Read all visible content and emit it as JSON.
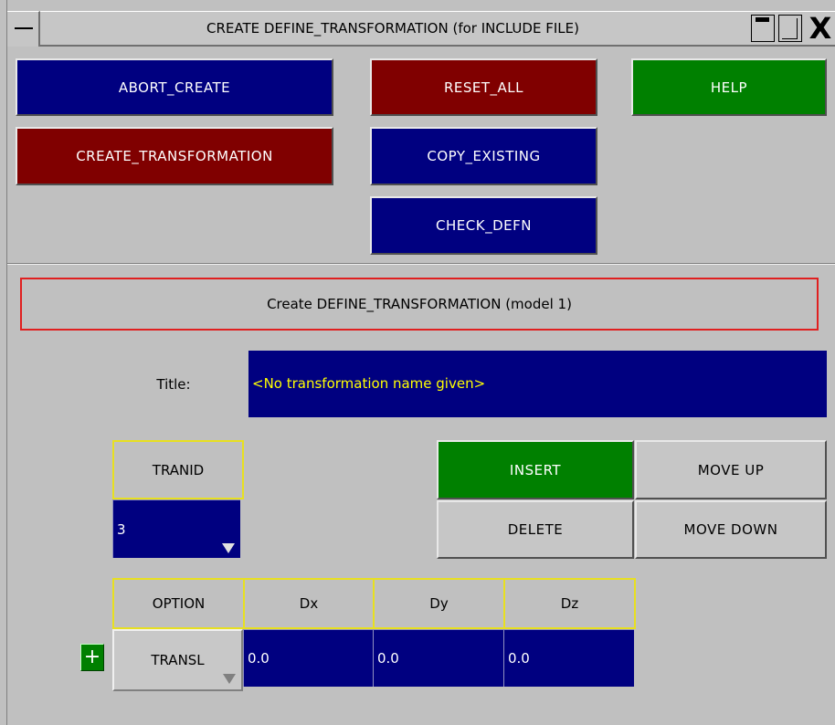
{
  "window": {
    "title": "CREATE DEFINE_TRANSFORMATION (for INCLUDE FILE)",
    "close_glyph": "X"
  },
  "toolbar": {
    "abort_create": "ABORT_CREATE",
    "reset_all": "RESET_ALL",
    "help": "HELP",
    "create_transformation": "CREATE_TRANSFORMATION",
    "copy_existing": "COPY_EXISTING",
    "check_defn": "CHECK_DEFN"
  },
  "info": {
    "text": "Create DEFINE_TRANSFORMATION (model 1)"
  },
  "title_field": {
    "label": "Title:",
    "value": "<No transformation name given>"
  },
  "tranid": {
    "header": "TRANID",
    "value": "3"
  },
  "row_actions": {
    "insert": "INSERT",
    "move_up": "MOVE UP",
    "delete": "DELETE",
    "move_down": "MOVE DOWN"
  },
  "table": {
    "headers": [
      "OPTION",
      "Dx",
      "Dy",
      "Dz"
    ],
    "rows": [
      {
        "add_glyph": "+",
        "option": "TRANSL",
        "dx": "0.0",
        "dy": "0.0",
        "dz": "0.0"
      }
    ]
  },
  "colors": {
    "blue_button": "#000080",
    "red_button": "#800000",
    "green_button": "#008000",
    "panel_bg": "#c0c0c0",
    "header_border": "#e8e020",
    "info_border": "#e02020",
    "title_text": "#ffff00"
  },
  "icons": {
    "system_menu": "system-menu-icon",
    "minimize": "minimize-icon",
    "maximize": "maximize-icon",
    "close": "close-icon",
    "dropdown": "dropdown-arrow-icon",
    "add_row": "plus-icon"
  }
}
